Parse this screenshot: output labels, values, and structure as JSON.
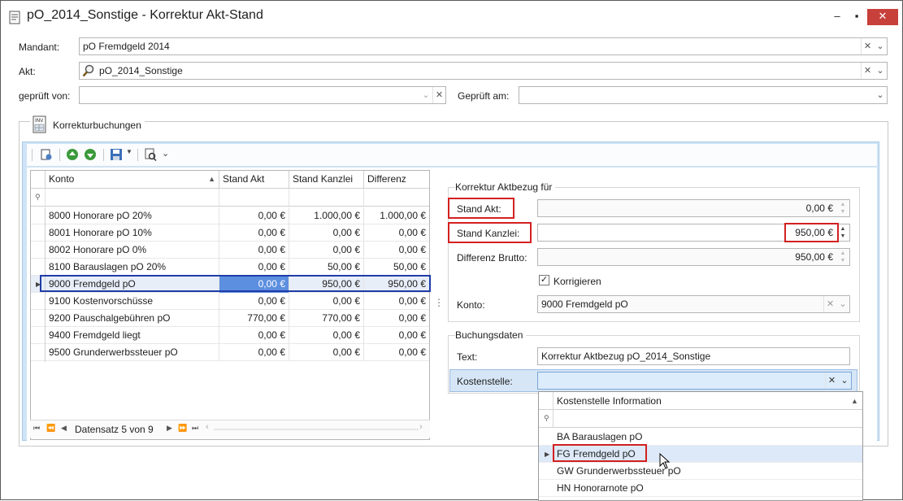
{
  "window": {
    "title": "pO_2014_Sonstige - Korrektur Akt-Stand",
    "minimize_icon": "minimize-icon",
    "maximize_icon": "maximize-icon",
    "close_icon": "close-icon",
    "close_color": "#c7403a"
  },
  "form": {
    "mandant_label": "Mandant:",
    "mandant_value": "pO Fremdgeld  2014",
    "akt_label": "Akt:",
    "akt_value": "pO_2014_Sonstige",
    "geprueft_von_label": "geprüft von:",
    "geprueft_von_value": "",
    "geprueft_am_label": "Geprüft am:",
    "geprueft_am_value": ""
  },
  "group": {
    "title": "Korrekturbuchungen"
  },
  "grid": {
    "columns": [
      "Konto",
      "Stand Akt",
      "Stand Kanzlei",
      "Differenz"
    ],
    "rows": [
      {
        "konto": "8000 Honorare pO 20%",
        "akt": "0,00 €",
        "kanzlei": "1.000,00 €",
        "diff": "1.000,00 €"
      },
      {
        "konto": "8001 Honorare pO 10%",
        "akt": "0,00 €",
        "kanzlei": "0,00 €",
        "diff": "0,00 €"
      },
      {
        "konto": "8002 Honorare pO 0%",
        "akt": "0,00 €",
        "kanzlei": "0,00 €",
        "diff": "0,00 €"
      },
      {
        "konto": "8100 Barauslagen pO 20%",
        "akt": "0,00 €",
        "kanzlei": "50,00 €",
        "diff": "50,00 €"
      },
      {
        "konto": "9000 Fremdgeld pO",
        "akt": "0,00 €",
        "kanzlei": "950,00 €",
        "diff": "950,00 €"
      },
      {
        "konto": "9100 Kostenvorschüsse",
        "akt": "0,00 €",
        "kanzlei": "0,00 €",
        "diff": "0,00 €"
      },
      {
        "konto": "9200 Pauschalgebühren pO",
        "akt": "770,00 €",
        "kanzlei": "770,00 €",
        "diff": "0,00 €"
      },
      {
        "konto": "9400 Fremdgeld liegt",
        "akt": "0,00 €",
        "kanzlei": "0,00 €",
        "diff": "0,00 €"
      },
      {
        "konto": "9500 Grunderwerbssteuer pO",
        "akt": "0,00 €",
        "kanzlei": "0,00 €",
        "diff": "0,00 €"
      }
    ],
    "selected_index": 4,
    "navigator": "Datensatz 5 von 9"
  },
  "korrektur": {
    "title": "Korrektur Aktbezug für",
    "stand_akt_label": "Stand Akt:",
    "stand_akt_value": "0,00 €",
    "stand_kanzlei_label": "Stand Kanzlei:",
    "stand_kanzlei_value": "950,00 €",
    "differenz_label": "Differenz Brutto:",
    "differenz_value": "950,00 €",
    "korrigieren_label": "Korrigieren",
    "korrigieren_checked": true,
    "konto_label": "Konto:",
    "konto_value": "9000 Fremdgeld pO"
  },
  "buchung": {
    "title": "Buchungsdaten",
    "text_label": "Text:",
    "text_value": "Korrektur Aktbezug pO_2014_Sonstige",
    "kostenstelle_label": "Kostenstelle:",
    "kostenstelle_value": ""
  },
  "dropdown": {
    "header": "Kostenstelle Information",
    "items": [
      "BA Barauslagen pO",
      "FG Fremdgeld pO",
      "GW Grunderwerbssteuer pO",
      "HN Honorarnote pO"
    ],
    "selected_index": 1
  },
  "colors": {
    "highlight_red": "#d32020",
    "selection_blue": "#1f3da8",
    "cell_accent": "#5d8fe0",
    "panel_blue": "#cfe4f6"
  }
}
